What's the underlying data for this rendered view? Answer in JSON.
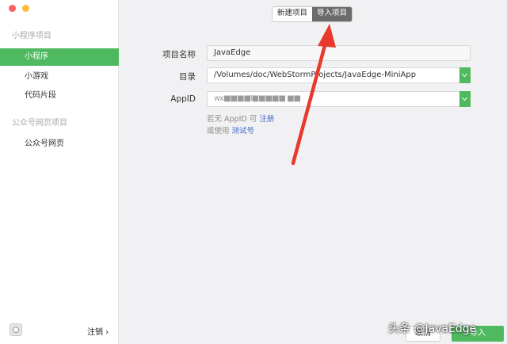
{
  "sidebar": {
    "miniprogram_section": "小程序项目",
    "items": [
      {
        "label": "小程序"
      },
      {
        "label": "小游戏"
      },
      {
        "label": "代码片段"
      }
    ],
    "official_section": "公众号网页项目",
    "official_items": [
      {
        "label": "公众号网页"
      }
    ],
    "logout_label": "注销 ›"
  },
  "tabs": [
    {
      "label": "新建项目"
    },
    {
      "label": "导入项目"
    }
  ],
  "form": {
    "project_name_label": "项目名称",
    "project_name_value": "JavaEdge",
    "directory_label": "目录",
    "directory_value": "/Volumes/doc/WebStormProjects/JavaEdge-MiniApp",
    "appid_label": "AppID",
    "appid_value": "wx■■■■l■■■■■ ■■"
  },
  "hints": {
    "no_appid_prefix": "若无 AppID 可 ",
    "register_link": "注册",
    "or_use_prefix": "或使用 ",
    "test_account_link": "测试号"
  },
  "buttons": {
    "cancel": "取消",
    "import": "导入"
  },
  "watermark": "头条 @JavaEdge",
  "colors": {
    "accent_green": "#4fb95f",
    "link_blue": "#3f6ccc",
    "annotation_red": "#e8392d"
  }
}
